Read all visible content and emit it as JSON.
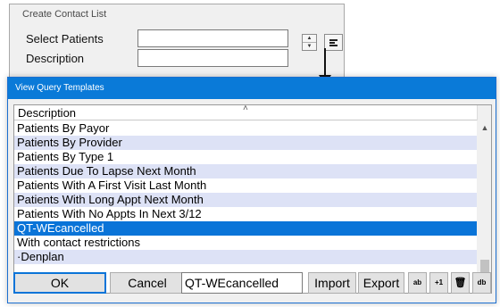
{
  "background_dialog": {
    "title": "Create Contact List",
    "select_patients_label": "Select Patients",
    "description_label": "Description",
    "select_patients_value": "",
    "description_value": ""
  },
  "window": {
    "title": "View Query Templates"
  },
  "grid": {
    "column_header": "Description",
    "sort_indicator": "˄",
    "rows": [
      {
        "text": "Patients By Payor",
        "style": "normal"
      },
      {
        "text": "Patients By Provider",
        "style": "alt"
      },
      {
        "text": "Patients By Type 1",
        "style": "normal"
      },
      {
        "text": "Patients Due To Lapse Next Month",
        "style": "alt"
      },
      {
        "text": "Patients With A First Visit Last Month",
        "style": "normal"
      },
      {
        "text": "Patients With Long Appt Next Month",
        "style": "alt"
      },
      {
        "text": "Patients With No Appts In Next 3/12",
        "style": "normal"
      },
      {
        "text": "QT-WEcancelled",
        "style": "sel"
      },
      {
        "text": "With contact restrictions",
        "style": "normal"
      },
      {
        "text": "·Denplan",
        "style": "alt"
      }
    ]
  },
  "footer": {
    "ok_label": "OK",
    "cancel_label": "Cancel",
    "template_name_value": "QT-WEcancelled",
    "import_label": "Import",
    "export_label": "Export",
    "edit_label": "ab",
    "add_label": "+1",
    "delete_label": "🗑",
    "db_label": "db"
  },
  "colors": {
    "title_bar": "#0a7ad8",
    "selection": "#0a74d8",
    "alt_row": "#dde2f6"
  }
}
